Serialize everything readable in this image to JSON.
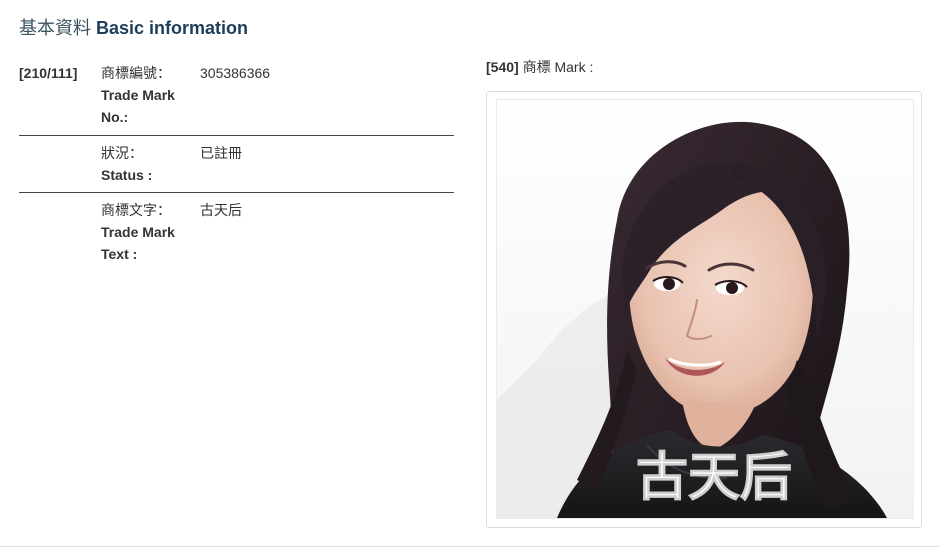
{
  "section": {
    "title_zh": "基本資料",
    "title_en": "Basic information"
  },
  "fields": {
    "code": "[210/111]",
    "trademark_no": {
      "label_zh": "商標編號：",
      "label_en": "Trade Mark No.:",
      "value": "305386366"
    },
    "status": {
      "label_zh": "狀況：",
      "label_en": "Status :",
      "value": "已註冊"
    },
    "trademark_text": {
      "label_zh": "商標文字：",
      "label_en": "Trade Mark Text :",
      "value": "古天后"
    }
  },
  "mark": {
    "code": "[540]",
    "label": "商標 Mark :",
    "image_text": "古天后",
    "image_description_icon": "portrait-photo"
  },
  "colors": {
    "heading_en": "#1d3d58",
    "heading_zh": "#3a5560",
    "text": "#333333",
    "frame_border": "#dcdcdc"
  }
}
